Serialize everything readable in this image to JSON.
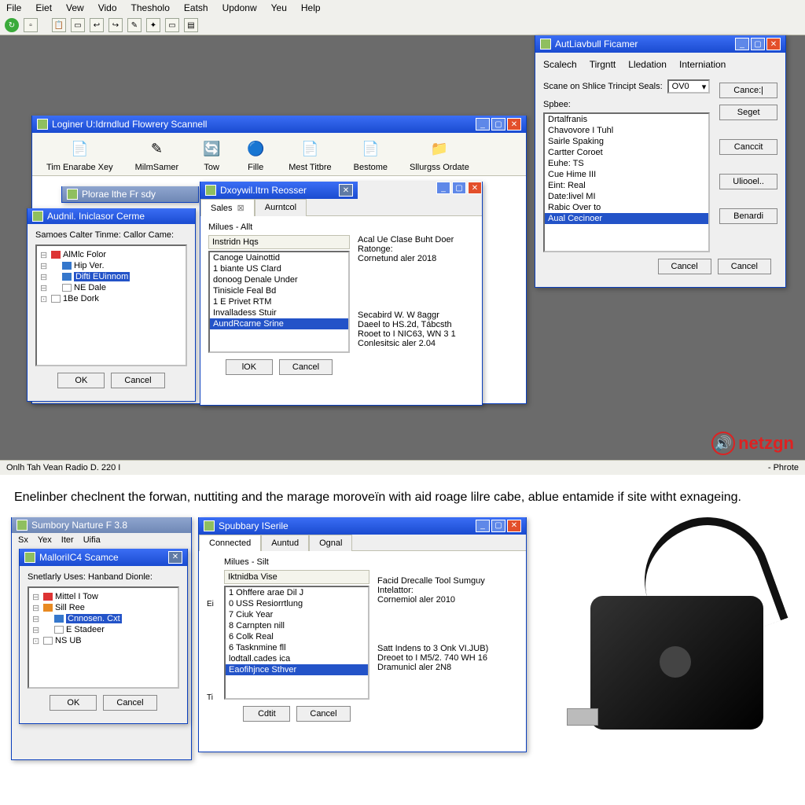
{
  "menu": {
    "items": [
      "File",
      "Eiet",
      "Vew",
      "Vido",
      "Thesholo",
      "Eatsh",
      "Updonw",
      "Yeu",
      "Help"
    ]
  },
  "status": {
    "left": "Onlh Tah Vean Radio D. 220 I",
    "right": "- Phrote"
  },
  "scanner": {
    "title": "Loginer U:Idrndlud Flowrery Scannell",
    "ribbon": [
      {
        "icon": "📄",
        "label": "Tim Enarabe Xey"
      },
      {
        "icon": "📄",
        "label": "MilmSamer"
      },
      {
        "icon": "🔄",
        "label": "Tow"
      },
      {
        "icon": "🔵",
        "label": "Fille"
      },
      {
        "icon": "📄",
        "label": "Mest Titbre"
      },
      {
        "icon": "📄",
        "label": "Bestome"
      },
      {
        "icon": "📁",
        "label": "Sllurgss Ordate"
      }
    ]
  },
  "audnil": {
    "title": "Audnil. Iniclasor Cerme",
    "heading": "Samoes Calter Tinme: Callor Came:",
    "tree": [
      {
        "label": "AlMlc Folor",
        "icon": "r"
      },
      {
        "label": "Hip Ver.",
        "icon": "b"
      },
      {
        "label": "Difti EUinnom",
        "icon": "b",
        "sel": true
      },
      {
        "label": "NE Dale",
        "icon": "p"
      },
      {
        "label": "1Be Dork",
        "icon": "p",
        "leaf": true
      }
    ],
    "ok": "OK",
    "cancel": "Cancel"
  },
  "plorae": {
    "title": "Plorae lthe Fr sdy"
  },
  "dxoy": {
    "title": "Dxoywil.Itrn Reosser",
    "tabs": [
      {
        "label": "Sales",
        "close": true,
        "active": true
      },
      {
        "label": "Aurntcol"
      }
    ],
    "listLabel": "Milues - Allt",
    "listHeader": "Instridn Hqs",
    "list": [
      "Canoge Uainottid",
      "1 biante US Clard",
      "donoog Denale Under",
      "Tinisicle Feal Bd",
      "1 E Privet RTM",
      "Invalladess Stuir",
      "AundRcarne Srine"
    ],
    "selIndex": 6,
    "ok": "lOK",
    "cancel": "Cancel",
    "right": {
      "h1": "Acal Ue Clase Buht Doer",
      "h2": "Ratonge:",
      "h3": "Cornetund aler 2018",
      "b1": "Secabird W. W 8aggr",
      "b2": "Daeel to HS.2d, Tábcsth",
      "b3": "Rooet to I NIC63, WN 3 1",
      "b4": "Conlesitsic aler 2.04"
    }
  },
  "ficamer": {
    "title": "AutLiavbull Ficamer",
    "tabs": [
      "Scalech",
      "Tirgntt",
      "Lledation",
      "Interniation"
    ],
    "fieldLabel": "Scane on Shlice Trincipt Seals:",
    "fieldValue": "OV0",
    "listLabel": "Spbee:",
    "list": [
      "Drtalfranis",
      "Chavovore I Tuhl",
      "Sairle Spaking",
      "Cartter Coroet",
      "Euhe: TS",
      "Cue Hime III",
      "Eint: Real",
      "Date:livel MI",
      "Rabic Over to",
      "Aual Cecinoer"
    ],
    "selIndex": 9,
    "btns": {
      "a": "Cance:|",
      "b": "Seget",
      "c": "Canccit",
      "d": "Uliooel..",
      "e": "Benardi"
    },
    "cancel": "Cancel"
  },
  "brand": "netzgn",
  "caption": "Enelinber checlnent the forwan, nuttiting and the marage moroveïn with aid roage lilre cabe, ablue entamide if site witht exnageing.",
  "sumbory": {
    "title": "Sumbory Narture F 3.8",
    "menu": [
      "Sx",
      "Yex",
      "Iter",
      "Uifia"
    ]
  },
  "malloril": {
    "title": "MalloriIC4 Scamce",
    "heading": "Snetlarly Uses: Hanband Dionle:",
    "tree": [
      {
        "label": "Mittel I Tow",
        "icon": "r"
      },
      {
        "label": "Sill Ree",
        "icon": "o"
      },
      {
        "label": "Cnnosen. Cxt",
        "icon": "b",
        "sel": true
      },
      {
        "label": "E Stadeer",
        "icon": "p"
      },
      {
        "label": "NS UB",
        "icon": "p",
        "leaf": true
      }
    ],
    "ok": "OK",
    "cancel": "Cancel"
  },
  "spubbary": {
    "title": "Spubbary ISerile",
    "tabs": [
      {
        "label": "Connected",
        "active": true
      },
      {
        "label": "Auntud"
      },
      {
        "label": "Ognal"
      }
    ],
    "listLabel": "Milues - Silt",
    "listHeader": "Iktnidba Vise",
    "list": [
      "1 Ohffere arae Dil J",
      "0 USS Resiorrtlung",
      "7 Ciuk Year",
      "8 Carnpten nill",
      "6 Colk Real",
      "6 Tasknmine fll",
      "lodtall.cades ica",
      "Eaofihjnce Sthver"
    ],
    "selIndex": 7,
    "ok": "Cdtit",
    "cancel": "Cancel",
    "right": {
      "h1": "Facid Drecalle Tool Sumguy",
      "h2": "Intelattor:",
      "h3": "Cornemiol aler 2010",
      "b1": "Satt Indens to 3 Onk VI.JUB)",
      "b2": "Dreoet to I M5/2. 740 WH 16",
      "b3": "Dramunicl aler 2N8"
    },
    "leftLabels": [
      "Ei",
      "Ti"
    ]
  }
}
